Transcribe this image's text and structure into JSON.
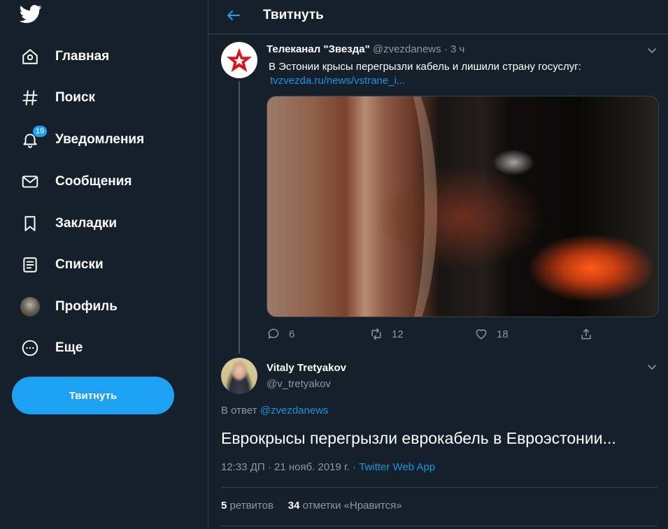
{
  "colors": {
    "background": "#15202b",
    "accent": "#1da1f2",
    "link": "#1b95e0",
    "muted": "#8899a6",
    "border": "#38444d"
  },
  "sidebar": {
    "logo_icon": "twitter-bird-icon",
    "items": [
      {
        "label": "Главная",
        "icon": "home-icon"
      },
      {
        "label": "Поиск",
        "icon": "hashtag-icon"
      },
      {
        "label": "Уведомления",
        "icon": "bell-icon",
        "badge": "19"
      },
      {
        "label": "Сообщения",
        "icon": "envelope-icon"
      },
      {
        "label": "Закладки",
        "icon": "bookmark-icon"
      },
      {
        "label": "Списки",
        "icon": "list-icon"
      },
      {
        "label": "Профиль",
        "icon": "avatar"
      },
      {
        "label": "Еще",
        "icon": "more-circle-icon"
      }
    ],
    "tweet_button": "Твитнуть"
  },
  "header": {
    "title": "Твитнуть",
    "back_icon": "arrow-left-icon"
  },
  "parent_tweet": {
    "name": "Телеканал \"Звезда\"",
    "handle": "@zvezdanews",
    "time": "3 ч",
    "text": "В Эстонии крысы перегрызли кабель и лишили страну госуслуг:",
    "link": "tvzvezda.ru/news/vstrane_i...",
    "actions": {
      "replies": "6",
      "retweets": "12",
      "likes": "18"
    }
  },
  "main_tweet": {
    "name": "Vitaly Tretyakov",
    "handle": "@v_tretyakov",
    "reply_prefix": "В ответ",
    "reply_to": "@zvezdanews",
    "text": "Еврокрысы перегрызли еврокабель в Евроэстонии...",
    "timestamp": "12:33 ДП · 21 нояб. 2019 г. ·",
    "source": "Twitter Web App",
    "retweets_count": "5",
    "retweets_label": "ретвитов",
    "likes_count": "34",
    "likes_label": "отметки «Нравится»"
  }
}
